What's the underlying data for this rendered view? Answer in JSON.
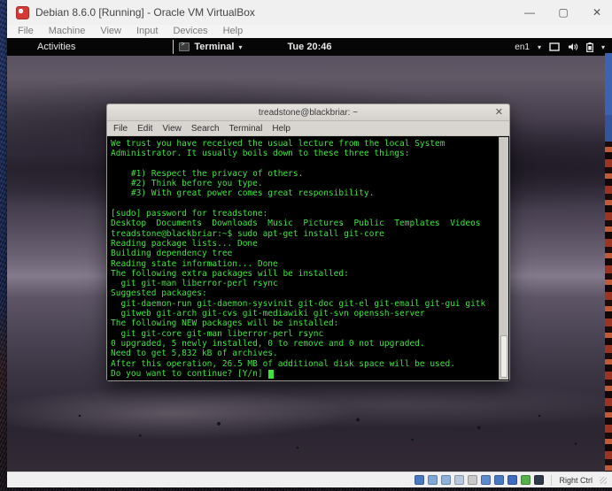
{
  "host_window": {
    "title": "Debian 8.6.0 [Running] - Oracle VM VirtualBox",
    "menu": [
      "File",
      "Machine",
      "View",
      "Input",
      "Devices",
      "Help"
    ],
    "controls": {
      "minimize": "—",
      "maximize": "▢",
      "close": "✕"
    }
  },
  "gnome_bar": {
    "activities": "Activities",
    "app_menu_label": "Terminal",
    "app_menu_caret": "▾",
    "clock": "Tue 20:46",
    "keyboard_layout": "en1",
    "keyboard_caret": "▾",
    "system_caret": "▾"
  },
  "terminal_window": {
    "title": "treadstone@blackbriar: ~",
    "menu": [
      "File",
      "Edit",
      "View",
      "Search",
      "Terminal",
      "Help"
    ],
    "lines": [
      "We trust you have received the usual lecture from the local System",
      "Administrator. It usually boils down to these three things:",
      "",
      "    #1) Respect the privacy of others.",
      "    #2) Think before you type.",
      "    #3) With great power comes great responsibility.",
      "",
      "[sudo] password for treadstone:",
      "Desktop  Documents  Downloads  Music  Pictures  Public  Templates  Videos",
      "treadstone@blackbriar:~$ sudo apt-get install git-core",
      "Reading package lists... Done",
      "Building dependency tree",
      "Reading state information... Done",
      "The following extra packages will be installed:",
      "  git git-man liberror-perl rsync",
      "Suggested packages:",
      "  git-daemon-run git-daemon-sysvinit git-doc git-el git-email git-gui gitk",
      "  gitweb git-arch git-cvs git-mediawiki git-svn openssh-server",
      "The following NEW packages will be installed:",
      "  git git-core git-man liberror-perl rsync",
      "0 upgraded, 5 newly installed, 0 to remove and 0 not upgraded.",
      "Need to get 5,832 kB of archives.",
      "After this operation, 26.5 MB of additional disk space will be used.",
      "Do you want to continue? [Y/n] "
    ]
  },
  "status_bar": {
    "host_key": "Right Ctrl",
    "icons": [
      {
        "name": "hdd-icon",
        "color": "#4a79c4"
      },
      {
        "name": "optical-drive-icon",
        "color": "#7fa8d9"
      },
      {
        "name": "audio-icon",
        "color": "#8fb0d8"
      },
      {
        "name": "network-icon",
        "color": "#b7c8de"
      },
      {
        "name": "usb-icon",
        "color": "#c9c9c9"
      },
      {
        "name": "shared-folders-icon",
        "color": "#5d8bd0"
      },
      {
        "name": "display-icon",
        "color": "#4a79c4"
      },
      {
        "name": "recording-icon",
        "color": "#3f6cc0"
      },
      {
        "name": "features-icon",
        "color": "#57b04a"
      },
      {
        "name": "mouse-integration-icon",
        "color": "#2e3a4a"
      }
    ]
  },
  "colors": {
    "terminal_green": "#3ce53c",
    "terminal_bg": "#000000",
    "gnome_bar_bg": "#060606"
  }
}
